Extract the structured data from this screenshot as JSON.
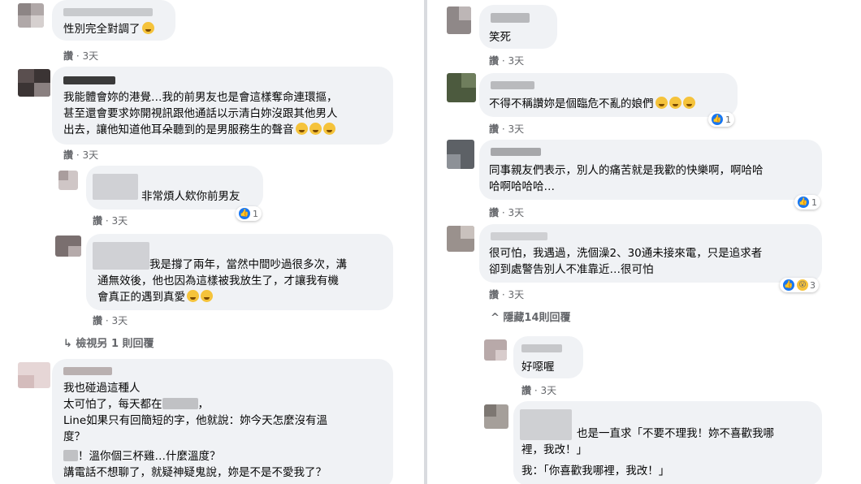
{
  "colors": {
    "bubble": "#f0f2f5",
    "meta": "#65676b",
    "text": "#050505",
    "like": "#1877f2"
  },
  "left": {
    "c1": {
      "text": "性別完全對調了",
      "meta_like": "讚",
      "meta_time": "· 3天"
    },
    "c2": {
      "text": "我能體會妳的港覺…我的前男友也是會這樣奪命連環摳，\n甚至還會要求妳開視訊跟他通話以示清白妳沒跟其他男人\n出去，讓他知道他耳朵聽到的是男服務生的聲音",
      "meta_like": "讚",
      "meta_time": "· 3天"
    },
    "c3": {
      "text": "非常煩人欸你前男友",
      "reactions": "1",
      "meta_like": "讚",
      "meta_time": "· 3天"
    },
    "c4": {
      "line1": "我是撐了兩年，當然中間吵過很多次，溝",
      "line2": "通無效後，他也因為這樣被我放生了，才讓我有機\n會真正的遇到真愛",
      "meta_like": "讚",
      "meta_time": "· 3天"
    },
    "more_replies": "檢視另 1 則回覆",
    "c5": {
      "l1": "我也碰過這種人",
      "l2a": "太可怕了，每天都在",
      "l2b": "，",
      "l3": "Line如果只有回簡短的字，他就說：妳今天怎麼沒有溫\n度？",
      "l4b": "！溫你個三杯雞…什麼溫度？",
      "l5": "講電話不想聊了，就疑神疑鬼說，妳是不是不愛我了？"
    }
  },
  "right": {
    "c1": {
      "text": "笑死",
      "meta_like": "讚",
      "meta_time": "· 3天"
    },
    "c2": {
      "text": "不得不稱讚妳是個臨危不亂的娘們",
      "reactions": "1",
      "meta_like": "讚",
      "meta_time": "· 3天"
    },
    "c3": {
      "text": "同事親友們表示，別人的痛苦就是我歡的快樂啊，啊哈哈\n哈啊哈哈哈…",
      "reactions": "1",
      "meta_like": "讚",
      "meta_time": "· 3天"
    },
    "c4": {
      "text": "很可怕，我遇過，洗個澡2、30通未接來電，只是追求者\n卻到處警告別人不准靠近…很可怕",
      "reactions": "3",
      "meta_like": "讚",
      "meta_time": "· 3天"
    },
    "hide_replies": "隱藏14則回覆",
    "c5": {
      "text": "好噁喔",
      "meta_like": "讚",
      "meta_time": "· 3天"
    },
    "c6": {
      "line1": "也是一直求「不要不理我！妳不喜歡我哪",
      "line2": "裡，我改！」",
      "line3": "我：「你喜歡我哪裡，我改！」"
    }
  }
}
